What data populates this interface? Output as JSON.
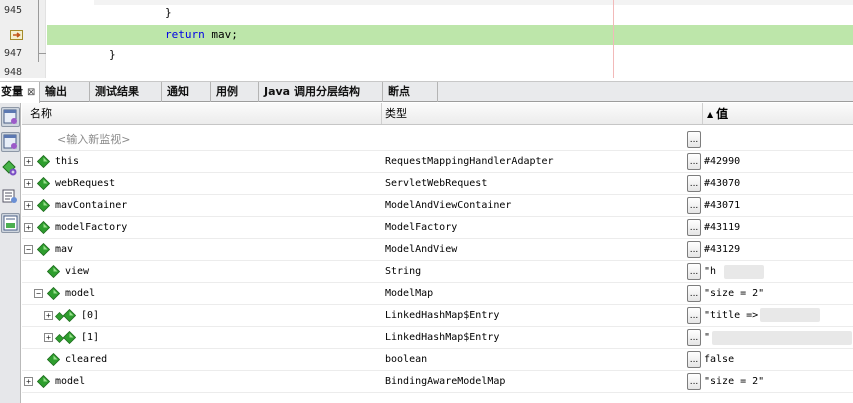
{
  "editor": {
    "lines": [
      {
        "number": "945",
        "code": "}",
        "indent": 16,
        "highlighted": false
      },
      {
        "number": "",
        "code": "return mav;",
        "keyword": "return",
        "rest": " mav;",
        "indent": 16,
        "highlighted": true
      },
      {
        "number": "947",
        "code": "}",
        "indent": 8,
        "highlighted": false
      },
      {
        "number": "948",
        "code": "",
        "indent": 0,
        "highlighted": false
      }
    ],
    "highlight_color": "#bde6aa",
    "keyword_color": "#0000e6"
  },
  "tabs": [
    {
      "label": "变量",
      "active": true,
      "close": "⊠"
    },
    {
      "label": "输出",
      "active": false
    },
    {
      "label": "测试结果",
      "active": false
    },
    {
      "label": "通知",
      "active": false
    },
    {
      "label": "用例",
      "active": false
    },
    {
      "label": "Java 调用分层结构",
      "active": false
    },
    {
      "label": "断点",
      "active": false
    }
  ],
  "table": {
    "columns": {
      "name": "名称",
      "type": "类型",
      "value": "值",
      "sort_icon": "up-triangle-icon"
    },
    "placeholder": "<输入新监视>",
    "ellipsis_label": "...",
    "rows": [
      {
        "depth": 0,
        "expander": "+",
        "name": "this",
        "type": "RequestMappingHandlerAdapter",
        "value": "#42990"
      },
      {
        "depth": 0,
        "expander": "+",
        "name": "webRequest",
        "type": "ServletWebRequest",
        "value": "#43070"
      },
      {
        "depth": 0,
        "expander": "+",
        "name": "mavContainer",
        "type": "ModelAndViewContainer",
        "value": "#43071"
      },
      {
        "depth": 0,
        "expander": "+",
        "name": "modelFactory",
        "type": "ModelFactory",
        "value": "#43119"
      },
      {
        "depth": 0,
        "expander": "-",
        "name": "mav",
        "type": "ModelAndView",
        "value": "#43129"
      },
      {
        "depth": 1,
        "expander": "",
        "name": "view",
        "type": "String",
        "value": "\"h"
      },
      {
        "depth": 1,
        "expander": "-",
        "name": "model",
        "type": "ModelMap",
        "value": "\"size = 2\""
      },
      {
        "depth": 2,
        "expander": "+",
        "name": "[0]",
        "type": "LinkedHashMap$Entry",
        "value": "\"title =>"
      },
      {
        "depth": 2,
        "expander": "+",
        "name": "[1]",
        "type": "LinkedHashMap$Entry",
        "value": "\""
      },
      {
        "depth": 1,
        "expander": "",
        "name": "cleared",
        "type": "boolean",
        "value": "false"
      },
      {
        "depth": 0,
        "expander": "+",
        "name": "model",
        "type": "BindingAwareModelMap",
        "value": "\"size = 2\""
      }
    ]
  },
  "colors": {
    "gem_green": "#2e9e2e",
    "gem_light": "#9be08f"
  }
}
